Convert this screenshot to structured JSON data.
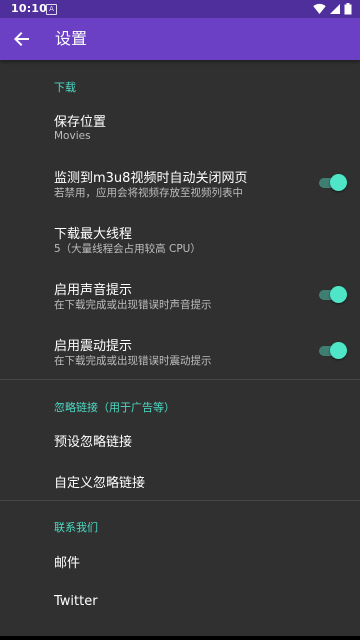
{
  "status_bar": {
    "time": "10:10",
    "notification_badge": "A",
    "icons": [
      "wifi-icon",
      "cell-signal-icon",
      "battery-icon"
    ]
  },
  "app_bar": {
    "title": "设置",
    "back_icon": "arrow-back-icon",
    "color": "#6b40c5"
  },
  "sections": {
    "download": {
      "header": "下载",
      "save_location": {
        "title": "保存位置",
        "summary": "Movies"
      },
      "auto_close": {
        "title": "监测到m3u8视频时自动关闭网页",
        "summary": "若禁用，应用会将视频存放至视频列表中",
        "enabled": true
      },
      "max_threads": {
        "title": "下载最大线程",
        "summary": "5（大量线程会占用较高 CPU）"
      },
      "sound_alert": {
        "title": "启用声音提示",
        "summary": "在下载完成或出现错误时声音提示",
        "enabled": true
      },
      "vibrate_alert": {
        "title": "启用震动提示",
        "summary": "在下载完成或出现错误时震动提示",
        "enabled": true
      }
    },
    "ignore_links": {
      "header": "忽略链接（用于广告等）",
      "preset": {
        "title": "预设忽略链接"
      },
      "custom": {
        "title": "自定义忽略链接"
      }
    },
    "contact": {
      "header": "联系我们",
      "email": {
        "title": "邮件"
      },
      "twitter": {
        "title": "Twitter"
      }
    }
  },
  "colors": {
    "background": "#303030",
    "accent": "#4dd9c3",
    "status_bar": "#4f2f9c"
  }
}
